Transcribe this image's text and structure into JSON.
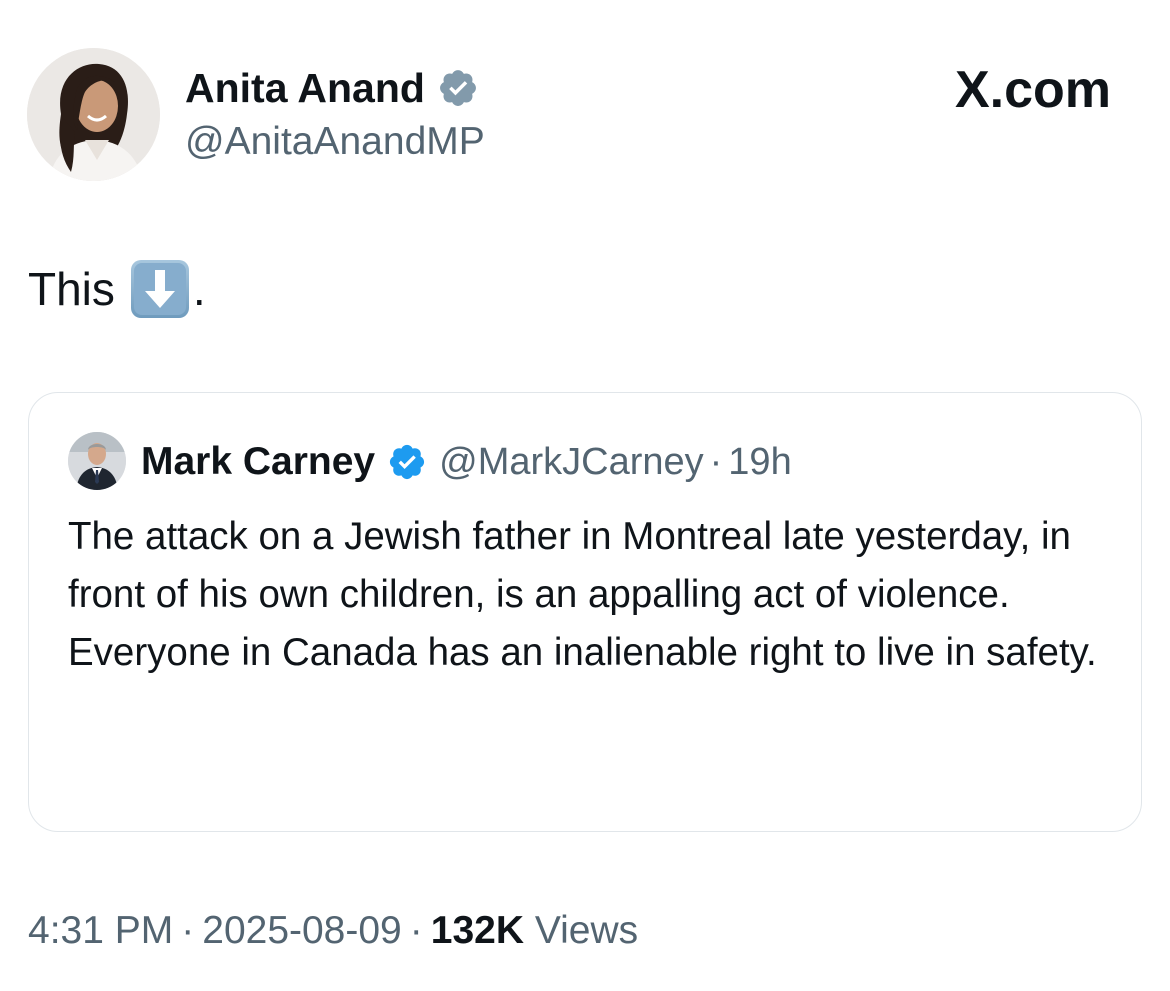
{
  "author": {
    "name": "Anita Anand",
    "handle": "@AnitaAnandMP",
    "verified": true,
    "avatar_icon": "woman-portrait-avatar"
  },
  "brand": {
    "site_label": "X.com",
    "logo_icon": "x-logo-icon"
  },
  "tweet": {
    "text": "This",
    "emoji_icon": "down-arrow-emoji-icon",
    "trailing": "."
  },
  "quoted_tweet": {
    "name": "Mark Carney",
    "handle": "@MarkJCarney",
    "dot": "·",
    "time": "19h",
    "verified": true,
    "verified_color": "#1d9bf0",
    "avatar_icon": "man-portrait-avatar",
    "text": "The attack on a Jewish father in Montreal late yesterday, in front of his own children, is an appalling act of violence. Everyone in Canada has an inalienable right to live in safety."
  },
  "meta": {
    "time": "4:31 PM",
    "sep1": "·",
    "date": "2025-08-09",
    "sep2": "·",
    "views_count": "132K",
    "views_label": "Views"
  },
  "colors": {
    "text_primary": "#0f1419",
    "text_secondary": "#536471",
    "border": "#e1e6ea",
    "verified_gray": "#829aab"
  }
}
